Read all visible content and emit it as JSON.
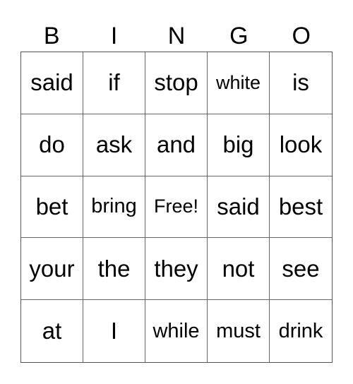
{
  "header": [
    "B",
    "I",
    "N",
    "G",
    "O"
  ],
  "grid": [
    [
      "said",
      "if",
      "stop",
      "white",
      "is"
    ],
    [
      "do",
      "ask",
      "and",
      "big",
      "look"
    ],
    [
      "bet",
      "bring",
      "Free!",
      "said",
      "best"
    ],
    [
      "your",
      "the",
      "they",
      "not",
      "see"
    ],
    [
      "at",
      "I",
      "while",
      "must",
      "drink"
    ]
  ]
}
